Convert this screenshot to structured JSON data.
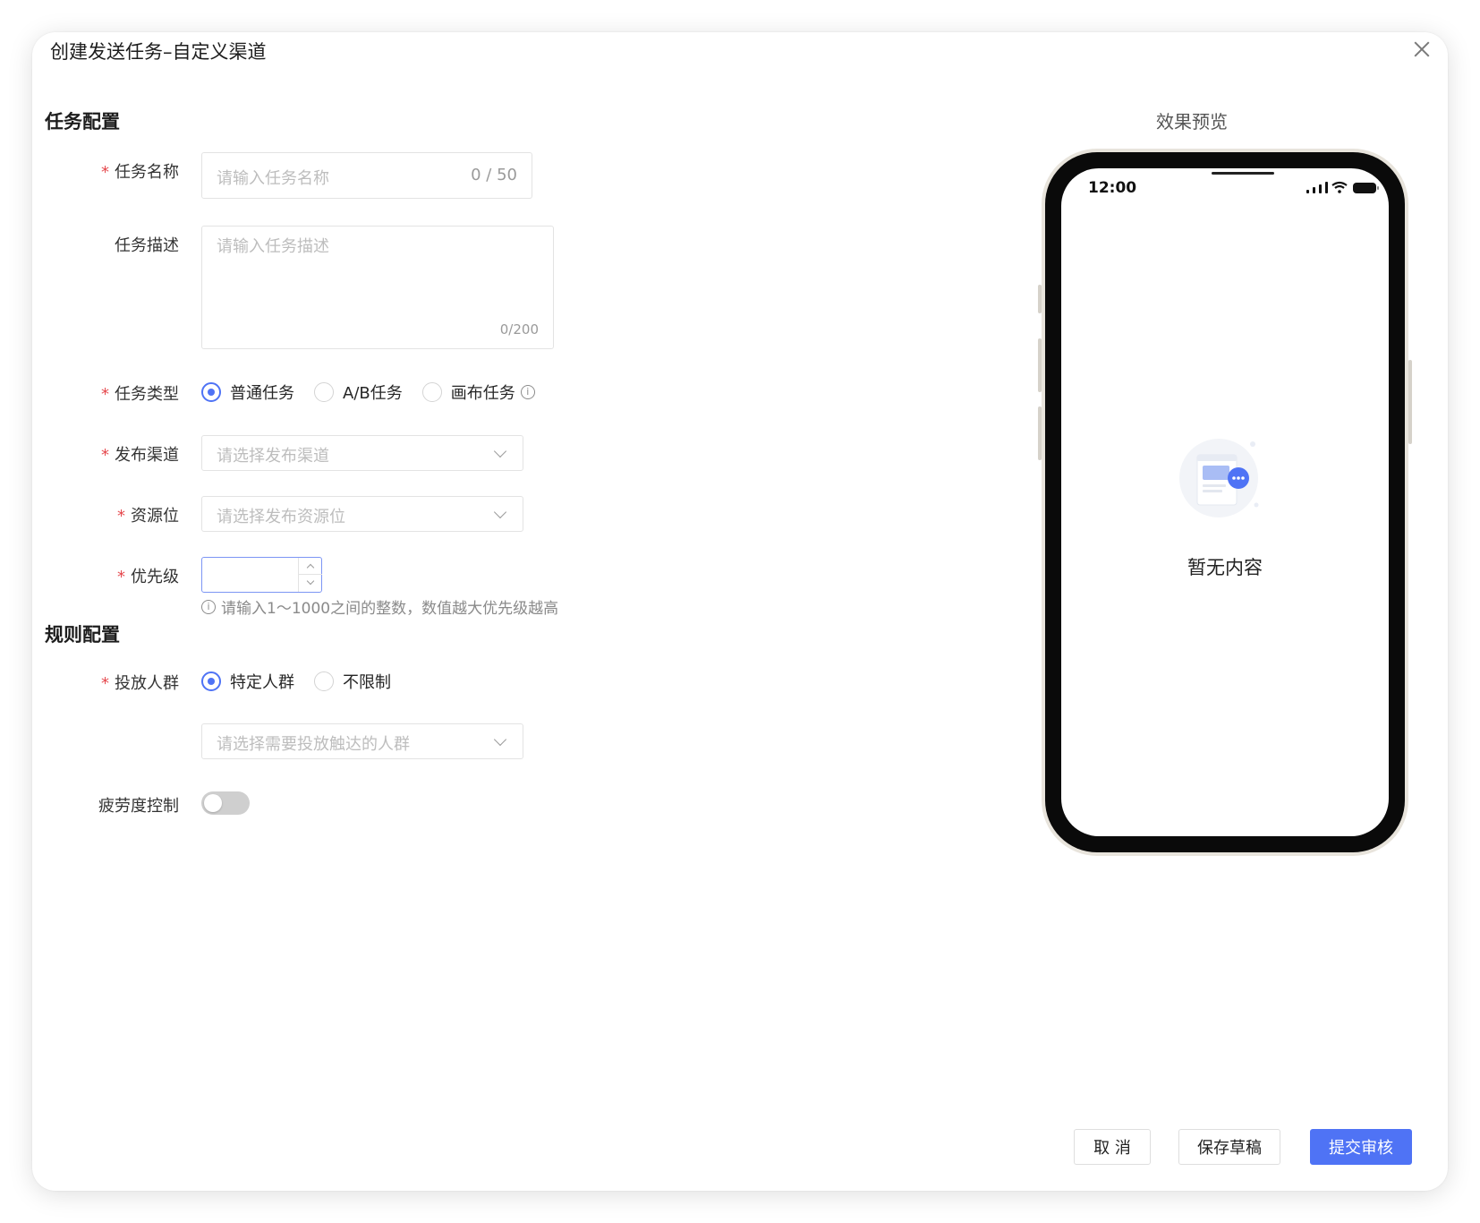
{
  "dialog": {
    "title": "创建发送任务–自定义渠道"
  },
  "sections": {
    "task_config": "任务配置",
    "rule_config": "规则配置",
    "preview": "效果预览"
  },
  "form": {
    "task_name": {
      "label": "任务名称",
      "placeholder": "请输入任务名称",
      "counter": "0 / 50"
    },
    "task_desc": {
      "label": "任务描述",
      "placeholder": "请输入任务描述",
      "counter": "0/200"
    },
    "task_type": {
      "label": "任务类型",
      "options": [
        "普通任务",
        "A/B任务",
        "画布任务"
      ],
      "selected": "普通任务"
    },
    "channel": {
      "label": "发布渠道",
      "placeholder": "请选择发布渠道"
    },
    "resource": {
      "label": "资源位",
      "placeholder": "请选择发布资源位"
    },
    "priority": {
      "label": "优先级",
      "value": "",
      "hint": "请输入1～1000之间的整数，数值越大优先级越高"
    },
    "audience": {
      "label": "投放人群",
      "options": [
        "特定人群",
        "不限制"
      ],
      "selected": "特定人群",
      "placeholder": "请选择需要投放触达的人群"
    },
    "fatigue": {
      "label": "疲劳度控制",
      "enabled": false
    }
  },
  "phone": {
    "time": "12:00",
    "empty_text": "暂无内容"
  },
  "footer": {
    "cancel": "取 消",
    "save_draft": "保存草稿",
    "submit": "提交审核"
  },
  "colors": {
    "primary": "#4f73f5",
    "required": "#e5484d"
  }
}
